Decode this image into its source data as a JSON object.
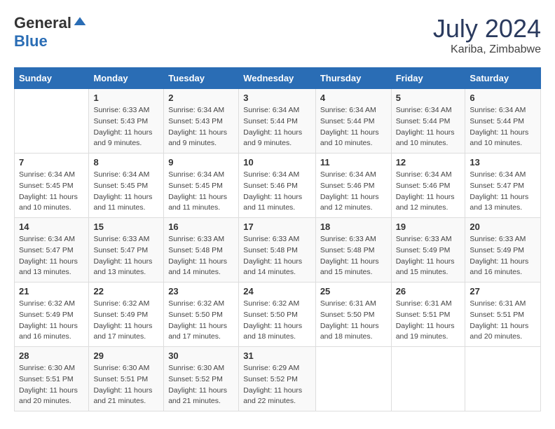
{
  "header": {
    "logo_general": "General",
    "logo_blue": "Blue",
    "month": "July 2024",
    "location": "Kariba, Zimbabwe"
  },
  "days_of_week": [
    "Sunday",
    "Monday",
    "Tuesday",
    "Wednesday",
    "Thursday",
    "Friday",
    "Saturday"
  ],
  "weeks": [
    [
      {
        "day": "",
        "info": ""
      },
      {
        "day": "1",
        "info": "Sunrise: 6:33 AM\nSunset: 5:43 PM\nDaylight: 11 hours\nand 9 minutes."
      },
      {
        "day": "2",
        "info": "Sunrise: 6:34 AM\nSunset: 5:43 PM\nDaylight: 11 hours\nand 9 minutes."
      },
      {
        "day": "3",
        "info": "Sunrise: 6:34 AM\nSunset: 5:44 PM\nDaylight: 11 hours\nand 9 minutes."
      },
      {
        "day": "4",
        "info": "Sunrise: 6:34 AM\nSunset: 5:44 PM\nDaylight: 11 hours\nand 10 minutes."
      },
      {
        "day": "5",
        "info": "Sunrise: 6:34 AM\nSunset: 5:44 PM\nDaylight: 11 hours\nand 10 minutes."
      },
      {
        "day": "6",
        "info": "Sunrise: 6:34 AM\nSunset: 5:44 PM\nDaylight: 11 hours\nand 10 minutes."
      }
    ],
    [
      {
        "day": "7",
        "info": ""
      },
      {
        "day": "8",
        "info": "Sunrise: 6:34 AM\nSunset: 5:45 PM\nDaylight: 11 hours\nand 11 minutes."
      },
      {
        "day": "9",
        "info": "Sunrise: 6:34 AM\nSunset: 5:45 PM\nDaylight: 11 hours\nand 11 minutes."
      },
      {
        "day": "10",
        "info": "Sunrise: 6:34 AM\nSunset: 5:46 PM\nDaylight: 11 hours\nand 11 minutes."
      },
      {
        "day": "11",
        "info": "Sunrise: 6:34 AM\nSunset: 5:46 PM\nDaylight: 11 hours\nand 12 minutes."
      },
      {
        "day": "12",
        "info": "Sunrise: 6:34 AM\nSunset: 5:46 PM\nDaylight: 11 hours\nand 12 minutes."
      },
      {
        "day": "13",
        "info": "Sunrise: 6:34 AM\nSunset: 5:47 PM\nDaylight: 11 hours\nand 13 minutes."
      }
    ],
    [
      {
        "day": "14",
        "info": ""
      },
      {
        "day": "15",
        "info": "Sunrise: 6:33 AM\nSunset: 5:47 PM\nDaylight: 11 hours\nand 13 minutes."
      },
      {
        "day": "16",
        "info": "Sunrise: 6:33 AM\nSunset: 5:48 PM\nDaylight: 11 hours\nand 14 minutes."
      },
      {
        "day": "17",
        "info": "Sunrise: 6:33 AM\nSunset: 5:48 PM\nDaylight: 11 hours\nand 14 minutes."
      },
      {
        "day": "18",
        "info": "Sunrise: 6:33 AM\nSunset: 5:48 PM\nDaylight: 11 hours\nand 15 minutes."
      },
      {
        "day": "19",
        "info": "Sunrise: 6:33 AM\nSunset: 5:49 PM\nDaylight: 11 hours\nand 15 minutes."
      },
      {
        "day": "20",
        "info": "Sunrise: 6:33 AM\nSunset: 5:49 PM\nDaylight: 11 hours\nand 16 minutes."
      }
    ],
    [
      {
        "day": "21",
        "info": ""
      },
      {
        "day": "22",
        "info": "Sunrise: 6:32 AM\nSunset: 5:49 PM\nDaylight: 11 hours\nand 17 minutes."
      },
      {
        "day": "23",
        "info": "Sunrise: 6:32 AM\nSunset: 5:50 PM\nDaylight: 11 hours\nand 17 minutes."
      },
      {
        "day": "24",
        "info": "Sunrise: 6:32 AM\nSunset: 5:50 PM\nDaylight: 11 hours\nand 18 minutes."
      },
      {
        "day": "25",
        "info": "Sunrise: 6:31 AM\nSunset: 5:50 PM\nDaylight: 11 hours\nand 18 minutes."
      },
      {
        "day": "26",
        "info": "Sunrise: 6:31 AM\nSunset: 5:51 PM\nDaylight: 11 hours\nand 19 minutes."
      },
      {
        "day": "27",
        "info": "Sunrise: 6:31 AM\nSunset: 5:51 PM\nDaylight: 11 hours\nand 20 minutes."
      }
    ],
    [
      {
        "day": "28",
        "info": "Sunrise: 6:30 AM\nSunset: 5:51 PM\nDaylight: 11 hours\nand 20 minutes."
      },
      {
        "day": "29",
        "info": "Sunrise: 6:30 AM\nSunset: 5:51 PM\nDaylight: 11 hours\nand 21 minutes."
      },
      {
        "day": "30",
        "info": "Sunrise: 6:30 AM\nSunset: 5:52 PM\nDaylight: 11 hours\nand 21 minutes."
      },
      {
        "day": "31",
        "info": "Sunrise: 6:29 AM\nSunset: 5:52 PM\nDaylight: 11 hours\nand 22 minutes."
      },
      {
        "day": "",
        "info": ""
      },
      {
        "day": "",
        "info": ""
      },
      {
        "day": "",
        "info": ""
      }
    ]
  ],
  "week1_day7_info": "Sunrise: 6:34 AM\nSunset: 5:45 PM\nDaylight: 11 hours\nand 10 minutes.",
  "week2_day14_info": "Sunrise: 6:34 AM\nSunset: 5:47 PM\nDaylight: 11 hours\nand 13 minutes.",
  "week3_day21_info": "Sunrise: 6:32 AM\nSunset: 5:49 PM\nDaylight: 11 hours\nand 16 minutes."
}
